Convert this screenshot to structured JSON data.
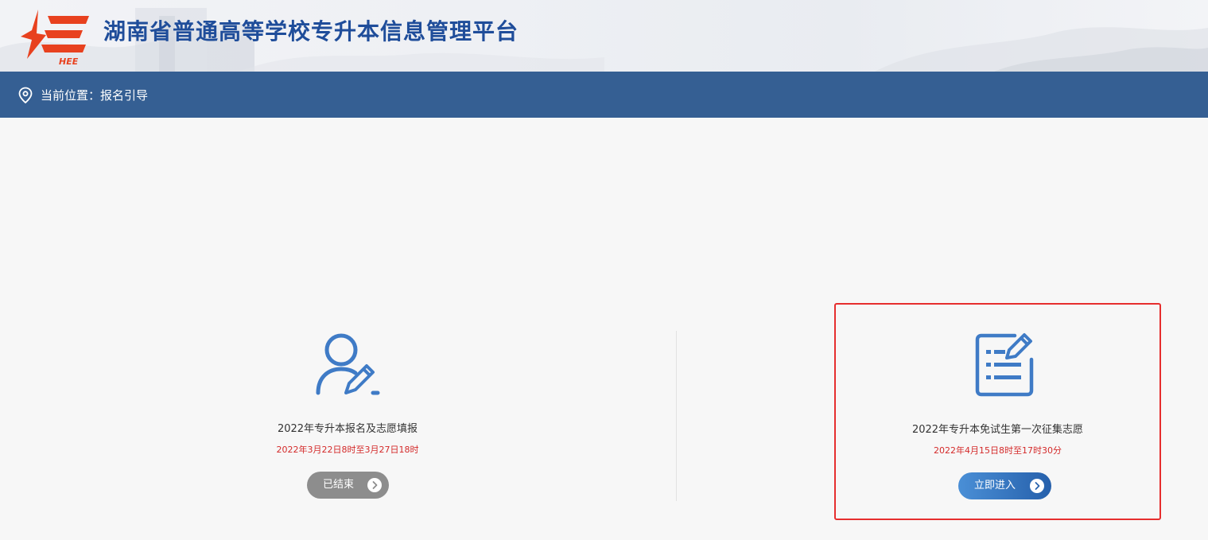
{
  "header": {
    "site_title": "湖南省普通高等学校专升本信息管理平台",
    "logo_text": "HEE"
  },
  "navbar": {
    "breadcrumb": "当前位置：报名引导"
  },
  "cards": [
    {
      "title": "2022年专升本报名及志愿填报",
      "time": "2022年3月22日8时至3月27日18时",
      "button_label": "已结束"
    },
    {
      "title": "2022年专升本免试生第一次征集志愿",
      "time": "2022年4月15日8时至17时30分",
      "button_label": "立即进入"
    }
  ],
  "colors": {
    "navbar": "#355f93",
    "title": "#1f4d9a",
    "logo": "#e8411f",
    "time_text": "#d42a2a",
    "button_ended": "#8d8d8d",
    "button_enter": "#3579c4",
    "highlight_border": "#e62e2e"
  }
}
